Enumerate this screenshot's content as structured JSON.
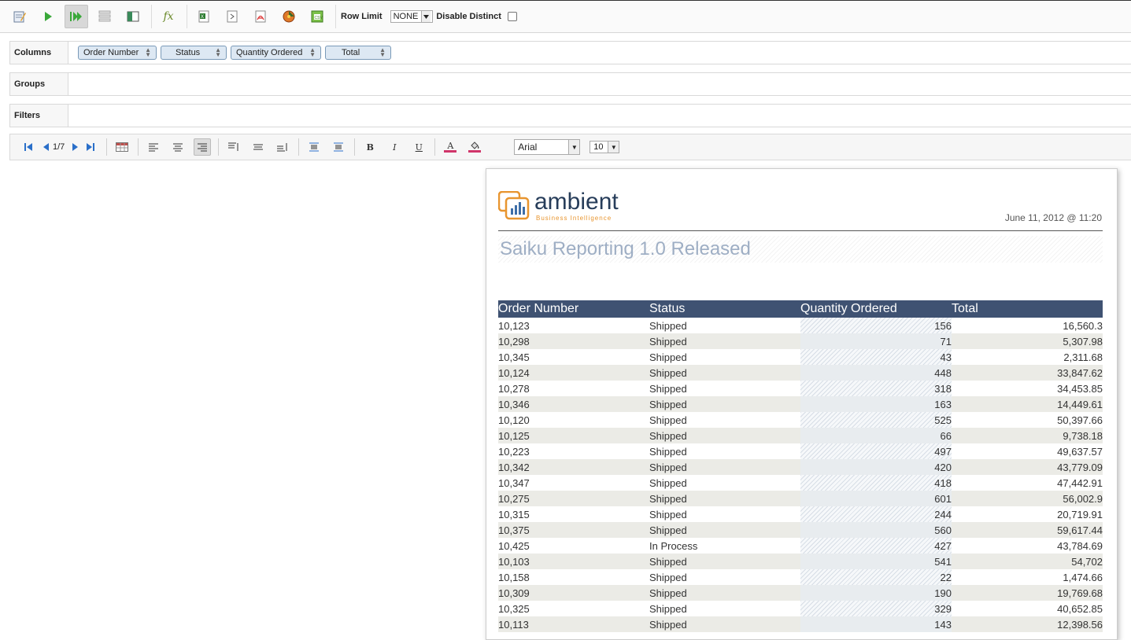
{
  "toolbar": {
    "buttons": [
      {
        "name": "edit-query-icon"
      },
      {
        "name": "run-icon"
      },
      {
        "name": "auto-run-icon",
        "active": true
      },
      {
        "name": "toggle-fields-icon"
      },
      {
        "name": "report-view-icon"
      },
      {
        "name": "formula-icon"
      },
      {
        "name": "export-xls-icon"
      },
      {
        "name": "export-cda-icon"
      },
      {
        "name": "export-pdf-icon"
      },
      {
        "name": "prpt-icon"
      },
      {
        "name": "export-csv-icon"
      }
    ],
    "row_limit_label": "Row Limit",
    "row_limit_value": "NONE",
    "disable_distinct_label": "Disable Distinct"
  },
  "zones": {
    "columns_label": "Columns",
    "columns": [
      "Order Number",
      "Status",
      "Quantity Ordered",
      "Total"
    ],
    "groups_label": "Groups",
    "filters_label": "Filters"
  },
  "report_toolbar": {
    "page": "1/7",
    "font": "Arial",
    "size": "10",
    "bold": "B",
    "italic": "I",
    "underline": "U",
    "font_color": "A"
  },
  "report": {
    "logo_text": "ambient",
    "logo_sub": "Business Intelligence",
    "date": "June 11, 2012 @ 11:20",
    "title": "Saiku Reporting 1.0 Released",
    "headers": [
      "Order Number",
      "Status",
      "Quantity Ordered",
      "Total"
    ],
    "rows": [
      [
        "10,123",
        "Shipped",
        "156",
        "16,560.3"
      ],
      [
        "10,298",
        "Shipped",
        "71",
        "5,307.98"
      ],
      [
        "10,345",
        "Shipped",
        "43",
        "2,311.68"
      ],
      [
        "10,124",
        "Shipped",
        "448",
        "33,847.62"
      ],
      [
        "10,278",
        "Shipped",
        "318",
        "34,453.85"
      ],
      [
        "10,346",
        "Shipped",
        "163",
        "14,449.61"
      ],
      [
        "10,120",
        "Shipped",
        "525",
        "50,397.66"
      ],
      [
        "10,125",
        "Shipped",
        "66",
        "9,738.18"
      ],
      [
        "10,223",
        "Shipped",
        "497",
        "49,637.57"
      ],
      [
        "10,342",
        "Shipped",
        "420",
        "43,779.09"
      ],
      [
        "10,347",
        "Shipped",
        "418",
        "47,442.91"
      ],
      [
        "10,275",
        "Shipped",
        "601",
        "56,002.9"
      ],
      [
        "10,315",
        "Shipped",
        "244",
        "20,719.91"
      ],
      [
        "10,375",
        "Shipped",
        "560",
        "59,617.44"
      ],
      [
        "10,425",
        "In Process",
        "427",
        "43,784.69"
      ],
      [
        "10,103",
        "Shipped",
        "541",
        "54,702"
      ],
      [
        "10,158",
        "Shipped",
        "22",
        "1,474.66"
      ],
      [
        "10,309",
        "Shipped",
        "190",
        "19,769.68"
      ],
      [
        "10,325",
        "Shipped",
        "329",
        "40,652.85"
      ],
      [
        "10,113",
        "Shipped",
        "143",
        "12,398.56"
      ]
    ]
  }
}
